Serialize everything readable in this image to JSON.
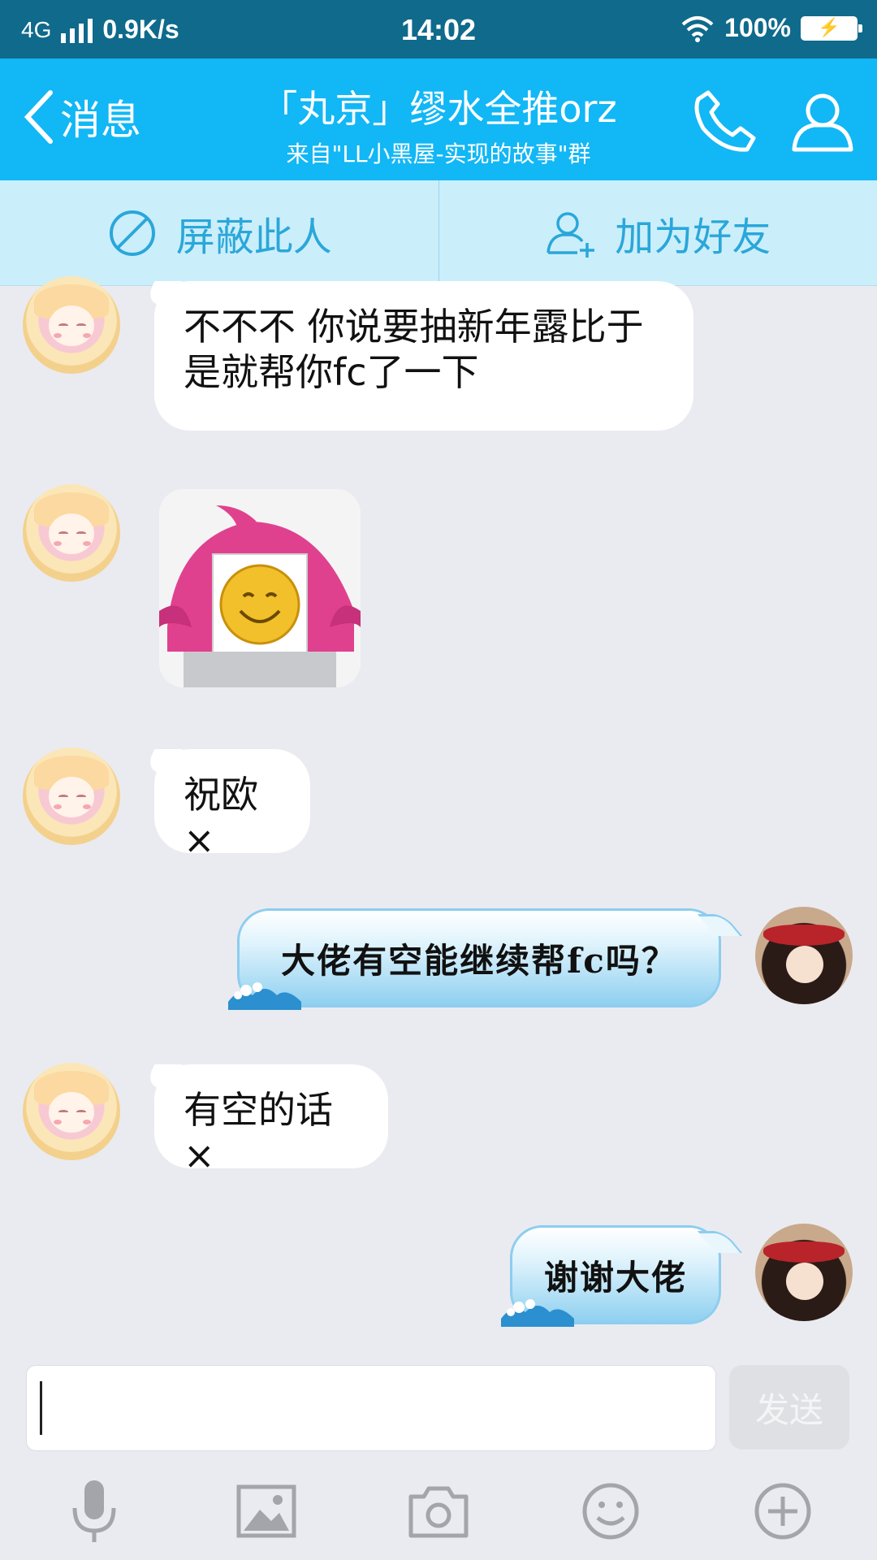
{
  "status_bar": {
    "network": "4G",
    "speed": "0.9K/s",
    "time": "14:02",
    "battery": "100%"
  },
  "header": {
    "back_label": "消息",
    "title": "「丸京」缪水全推orz",
    "subtitle": "来自\"LL小黑屋-实现的故事\"群",
    "icons": [
      "phone-icon",
      "profile-icon"
    ]
  },
  "actions": {
    "block_label": "屏蔽此人",
    "add_friend_label": "加为好友"
  },
  "messages": [
    {
      "sender": "other",
      "type": "text",
      "text": "不不不 你说要抽新年露比于\n是就帮你fc了一下"
    },
    {
      "sender": "other",
      "type": "sticker",
      "text": ""
    },
    {
      "sender": "other",
      "type": "text",
      "text": "祝欧×"
    },
    {
      "sender": "self",
      "type": "text",
      "text": "大佬有空能继续帮fc吗？"
    },
    {
      "sender": "other",
      "type": "text",
      "text": "有空的话×"
    },
    {
      "sender": "self",
      "type": "text",
      "text": "谢谢大佬"
    }
  ],
  "input": {
    "value": "",
    "placeholder": "",
    "send_label": "发送"
  },
  "toolbar": [
    "microphone-icon",
    "image-icon",
    "camera-icon",
    "emoji-icon",
    "plus-icon"
  ],
  "colors": {
    "status_bar": "#0f6a8c",
    "header": "#12b7f5",
    "action_bar": "#cbeefb",
    "action_text": "#2aa7d9",
    "background": "#eaebf0"
  }
}
